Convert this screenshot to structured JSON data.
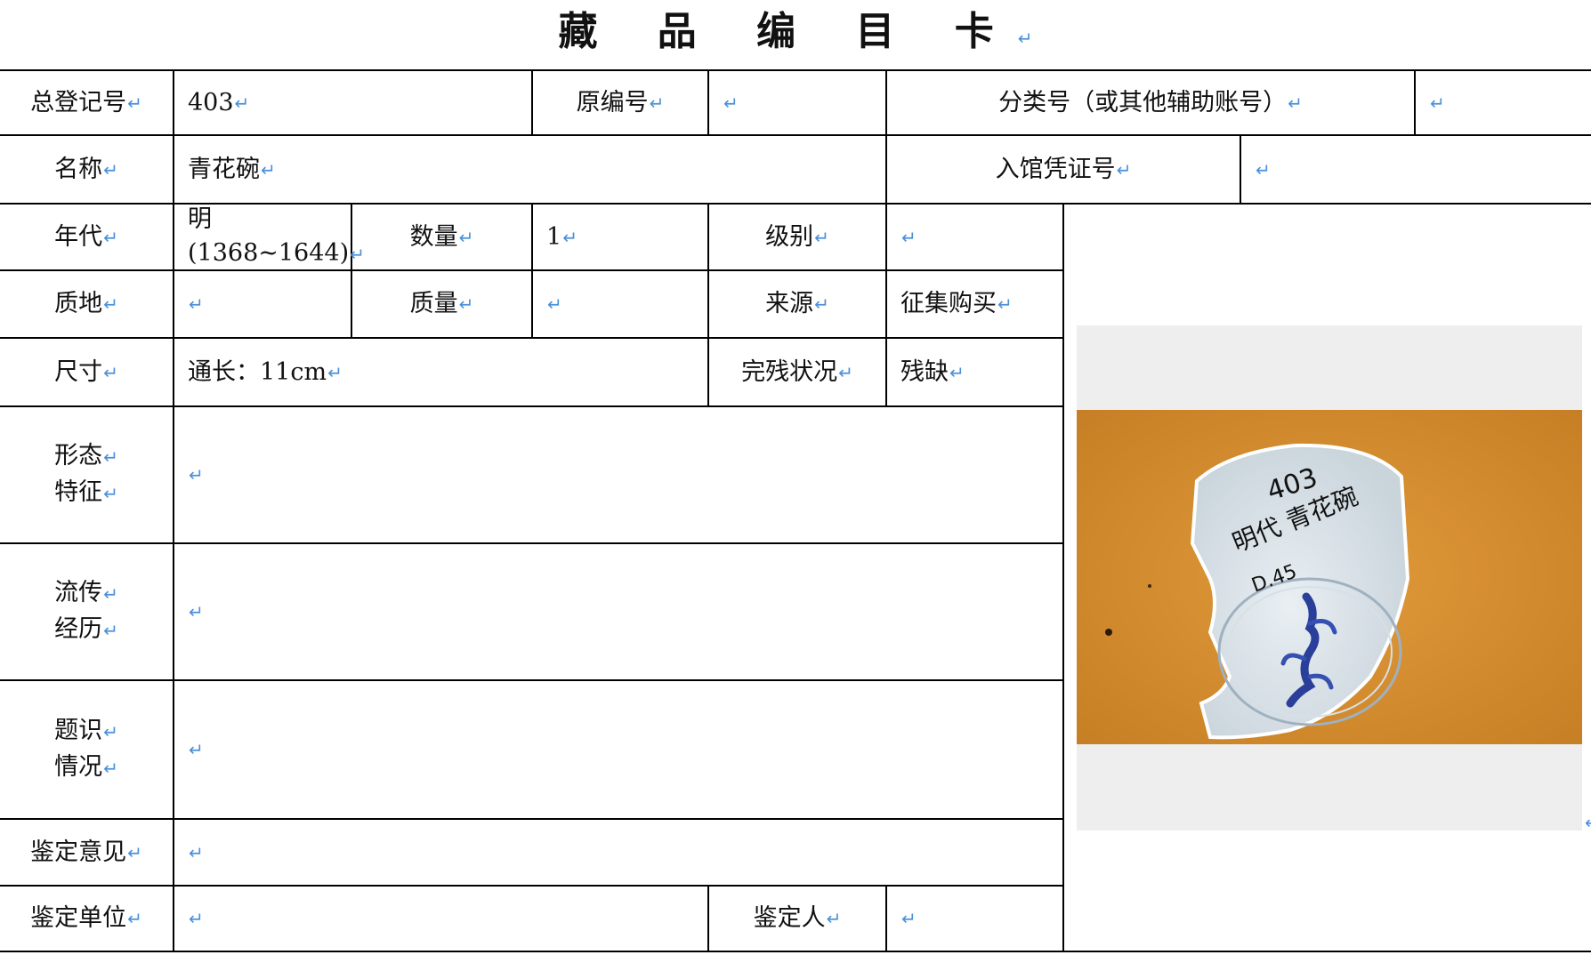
{
  "title": "藏 品 编 目 卡",
  "return_mark": "↵",
  "fields": {
    "total_reg_no": {
      "label": "总登记号",
      "value": "403"
    },
    "original_no": {
      "label": "原编号",
      "value": ""
    },
    "class_no": {
      "label": "分类号（或其他辅助账号）",
      "value": ""
    },
    "name": {
      "label": "名称",
      "value": "青花碗"
    },
    "entry_voucher_no": {
      "label": "入馆凭证号",
      "value": ""
    },
    "era": {
      "label": "年代",
      "value_line1": "明",
      "value_line2": "(1368~1644)"
    },
    "quantity": {
      "label": "数量",
      "value": "1"
    },
    "grade": {
      "label": "级别",
      "value": ""
    },
    "material": {
      "label": "质地",
      "value": ""
    },
    "weight": {
      "label": "质量",
      "value": ""
    },
    "source": {
      "label": "来源",
      "value": "征集购买"
    },
    "size": {
      "label": "尺寸",
      "value": "通长：11cm"
    },
    "condition": {
      "label": "完残状况",
      "value": "残缺"
    },
    "shape_features": {
      "label_line1": "形态",
      "label_line2": "特征",
      "value": ""
    },
    "provenance": {
      "label_line1": "流传",
      "label_line2": "经历",
      "value": ""
    },
    "inscription": {
      "label_line1": "题识",
      "label_line2": "情况",
      "value": ""
    },
    "appraisal_opinion": {
      "label": "鉴定意见",
      "value": ""
    },
    "appraisal_unit": {
      "label": "鉴定单位",
      "value": ""
    },
    "appraiser": {
      "label": "鉴定人",
      "value": ""
    }
  },
  "photo": {
    "inscription_line1": "403",
    "inscription_line2": "明代 青花碗",
    "inscription_line3": "D.45"
  },
  "colors": {
    "return_mark": "#4a90d9",
    "photo_bg": "#d98e2f",
    "frame_bg": "#eeeeee"
  }
}
